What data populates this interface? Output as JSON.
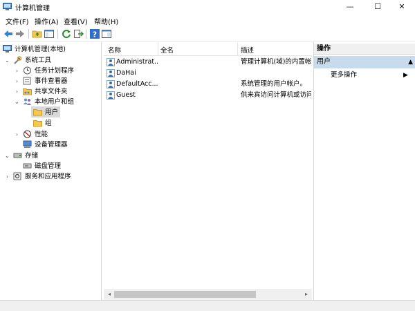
{
  "window": {
    "title": "计算机管理",
    "minimize": "—",
    "maximize": "☐",
    "close": "✕"
  },
  "menu": {
    "items": [
      "文件(F)",
      "操作(A)",
      "查看(V)",
      "帮助(H)"
    ]
  },
  "toolbar": {
    "icons": [
      "back-icon",
      "forward-icon",
      "up-icon",
      "show-hide-tree-icon",
      "refresh-icon",
      "export-list-icon",
      "help-icon",
      "action-pane-icon"
    ]
  },
  "tree": {
    "root": "计算机管理(本地)",
    "system_tools": "系统工具",
    "task_scheduler": "任务计划程序",
    "event_viewer": "事件查看器",
    "shared_folders": "共享文件夹",
    "local_users_groups": "本地用户和组",
    "users": "用户",
    "groups": "组",
    "performance": "性能",
    "device_manager": "设备管理器",
    "storage": "存储",
    "disk_management": "磁盘管理",
    "services_apps": "服务和应用程序"
  },
  "list": {
    "columns": [
      "名称",
      "全名",
      "描述"
    ],
    "rows": [
      {
        "name": "Administrat...",
        "fullname": "",
        "desc": "管理计算机(域)的内置帐..."
      },
      {
        "name": "DaHai",
        "fullname": "",
        "desc": ""
      },
      {
        "name": "DefaultAcc...",
        "fullname": "",
        "desc": "系统管理的用户帐户。"
      },
      {
        "name": "Guest",
        "fullname": "",
        "desc": "供来宾访问计算机或访问..."
      }
    ]
  },
  "actions": {
    "header": "操作",
    "section": "用户",
    "more": "更多操作"
  },
  "colors": {
    "selection": "#d9d9d9",
    "action_section": "#c8dbed",
    "folder": "#f5c94f",
    "nav_arrow": "#2f83d4"
  }
}
